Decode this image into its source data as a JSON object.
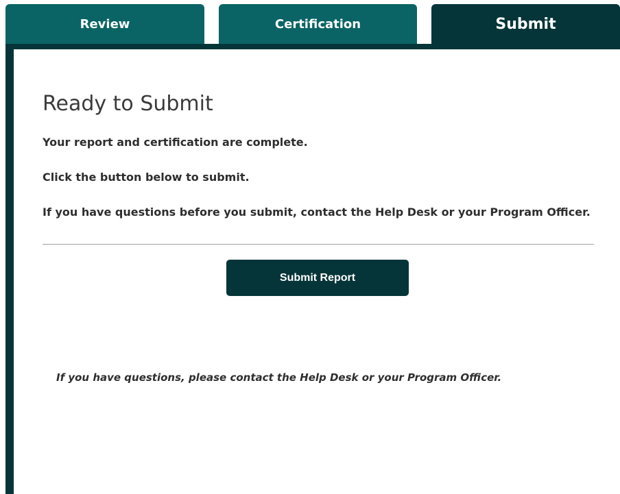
{
  "tabs": {
    "review": "Review",
    "certification": "Certification",
    "submit": "Submit",
    "active": "submit"
  },
  "colors": {
    "tab_inactive": "#0a6465",
    "tab_active": "#053539",
    "button": "#053539"
  },
  "main": {
    "heading": "Ready to Submit",
    "messages": [
      "Your report and certification are complete.",
      "Click the button below to submit.",
      "If you have questions before you submit, contact the Help Desk or your Program Officer."
    ],
    "submit_button": "Submit Report",
    "footer_note": "If you have questions, please contact the Help Desk or your Program Officer."
  }
}
